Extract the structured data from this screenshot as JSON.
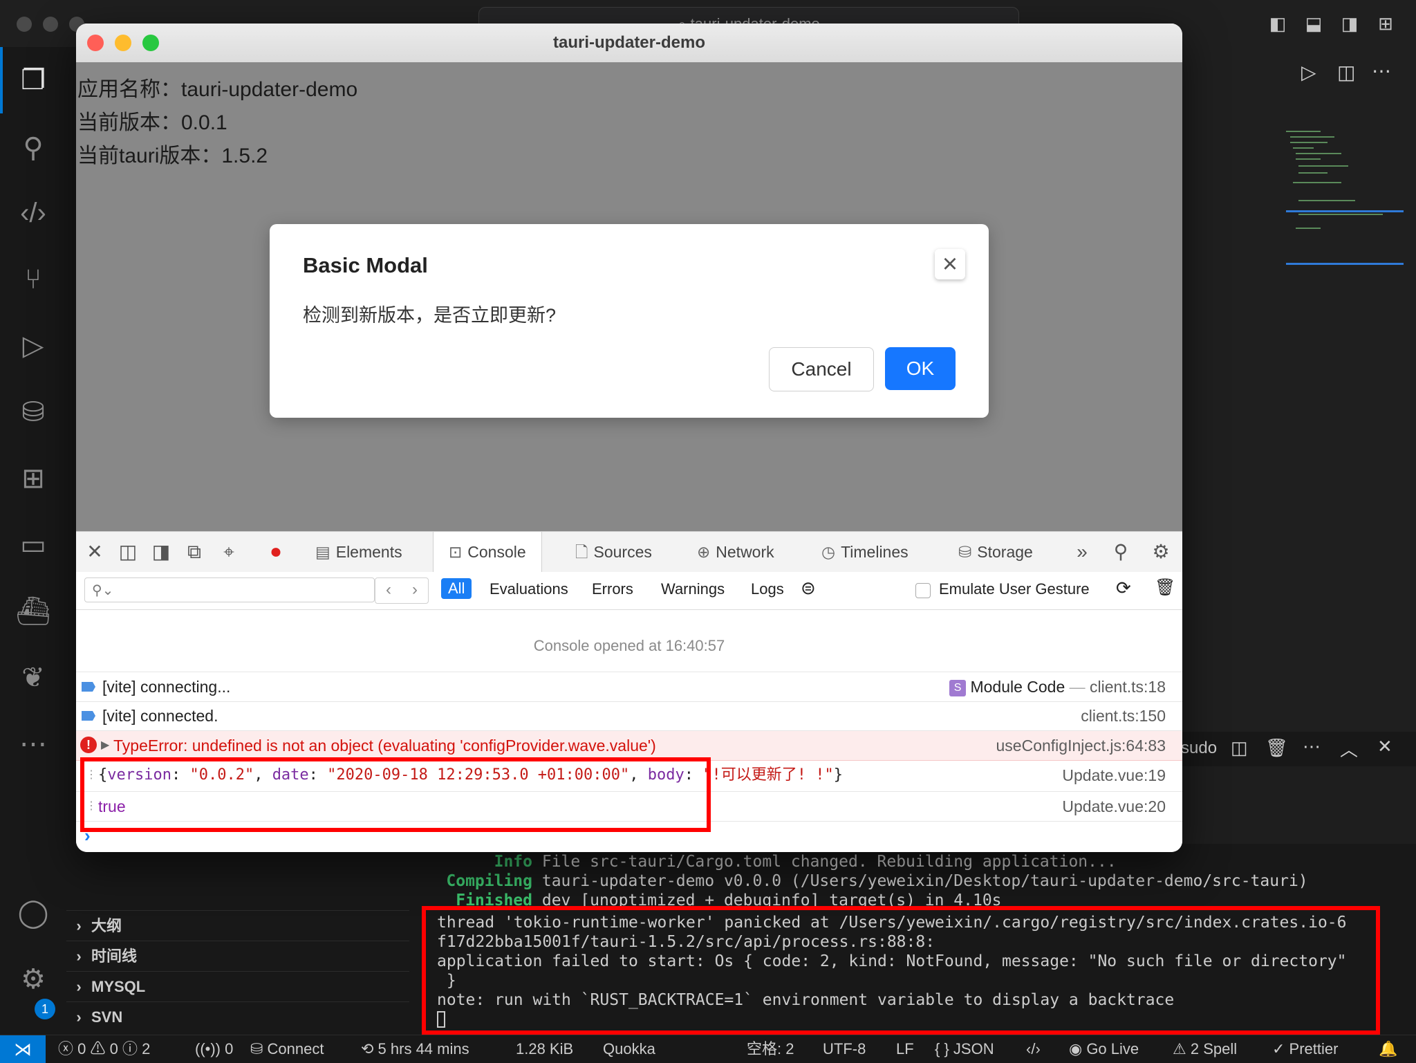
{
  "vscode": {
    "search_text": "tauri-updater-demo",
    "sidebar_sections": [
      "大纲",
      "时间线",
      "MYSQL",
      "SVN"
    ],
    "panel_tail_label": "sudo",
    "settings_badge": "1"
  },
  "terminal": {
    "lines_partial": [
      {
        "tag": "Info",
        "text": "File src-tauri/Cargo.toml changed. Rebuilding application..."
      },
      {
        "tag": "Compiling",
        "text": "tauri-updater-demo v0.0.0 (/Users/yeweixin/Desktop/tauri-updater-demo/src-tauri)"
      },
      {
        "tag": "Finished",
        "text": "dev [unoptimized + debuginfo] target(s) in 4.10s"
      }
    ],
    "error_lines": [
      "thread 'tokio-runtime-worker' panicked at /Users/yeweixin/.cargo/registry/src/index.crates.io-6",
      "f17d22bba15001f/tauri-1.5.2/src/api/process.rs:88:8:",
      "application failed to start: Os { code: 2, kind: NotFound, message: \"No such file or directory\"",
      " }",
      "note: run with `RUST_BACKTRACE=1` environment variable to display a backtrace"
    ]
  },
  "statusbar": {
    "errors": "0",
    "warnings": "0",
    "infos": "2",
    "ports": "0",
    "connect": "Connect",
    "time": "5 hrs 44 mins",
    "size": "1.28 KiB",
    "quokka": "Quokka",
    "indent": "空格: 2",
    "encoding": "UTF-8",
    "eol": "LF",
    "language": "JSON",
    "golive": "Go Live",
    "spell": "2 Spell",
    "prettier": "Prettier"
  },
  "tauri": {
    "window_title": "tauri-updater-demo",
    "app_name_line": "应用名称：tauri-updater-demo",
    "version_line": "当前版本：0.0.1",
    "tauri_version_line": "当前tauri版本：1.5.2",
    "modal": {
      "title": "Basic Modal",
      "body": "检测到新版本，是否立即更新?",
      "cancel": "Cancel",
      "ok": "OK"
    }
  },
  "devtools": {
    "tabs": [
      "Elements",
      "Console",
      "Sources",
      "Network",
      "Timelines",
      "Storage"
    ],
    "filters": [
      "All",
      "Evaluations",
      "Errors",
      "Warnings",
      "Logs"
    ],
    "emulate_label": "Emulate User Gesture",
    "console_opened": "Console opened at 16:40:57",
    "logs": [
      {
        "msg": "[vite] connecting...",
        "src_label": "Module Code",
        "src_sep": " — ",
        "src": "client.ts:18"
      },
      {
        "msg": "[vite] connected.",
        "src": "client.ts:150"
      },
      {
        "msg": "TypeError: undefined is not an object (evaluating 'configProvider.wave.value')",
        "src": "useConfigInject.js:64:83"
      },
      {
        "object": {
          "k1": "version",
          "v1": "\"0.0.2\"",
          "k2": "date",
          "v2": "\"2020-09-18 12:29:53.0 +01:00:00\"",
          "k3": "body",
          "v3": "\"!可以更新了! !\""
        },
        "src": "Update.vue:19"
      },
      {
        "msg": "true",
        "src": "Update.vue:20"
      }
    ]
  }
}
